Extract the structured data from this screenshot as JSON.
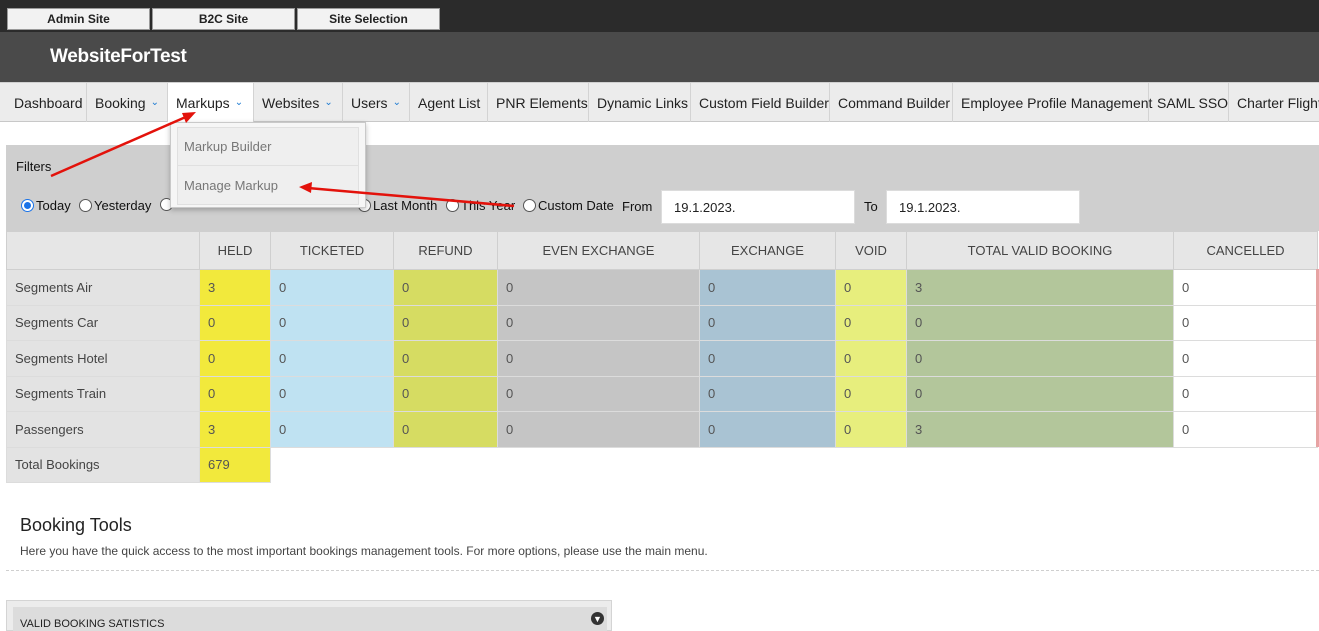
{
  "topbar": {
    "buttons": [
      "Admin Site",
      "B2C Site",
      "Site Selection"
    ]
  },
  "brand": "WebsiteForTest",
  "nav": {
    "items": [
      {
        "label": "Dashboard"
      },
      {
        "label": "Booking",
        "chevron": true
      },
      {
        "label": "Markups",
        "chevron": true,
        "active": true
      },
      {
        "label": "Websites",
        "chevron": true
      },
      {
        "label": "Users",
        "chevron": true
      },
      {
        "label": "Agent List"
      },
      {
        "label": "PNR Elements"
      },
      {
        "label": "Dynamic Links"
      },
      {
        "label": "Custom Field Builder"
      },
      {
        "label": "Command Builder"
      },
      {
        "label": "Employee Profile Management"
      },
      {
        "label": "SAML SSO"
      },
      {
        "label": "Charter Flight"
      }
    ],
    "dropdown": [
      "Markup Builder",
      "Manage Markup"
    ]
  },
  "filters": {
    "title": "Filters",
    "radios": [
      "Today",
      "Yesterday",
      "Last Month",
      "This Year",
      "Custom Date"
    ],
    "selected": "Today",
    "from_label": "From",
    "from_value": "19.1.2023.",
    "to_label": "To",
    "to_value": "19.1.2023."
  },
  "table": {
    "columns": [
      "HELD",
      "TICKETED",
      "REFUND",
      "EVEN EXCHANGE",
      "EXCHANGE",
      "VOID",
      "TOTAL VALID BOOKING",
      "CANCELLED"
    ],
    "rows": [
      {
        "label": "Segments Air",
        "values": [
          "3",
          "0",
          "0",
          "0",
          "0",
          "0",
          "3",
          "0"
        ]
      },
      {
        "label": "Segments Car",
        "values": [
          "0",
          "0",
          "0",
          "0",
          "0",
          "0",
          "0",
          "0"
        ]
      },
      {
        "label": "Segments Hotel",
        "values": [
          "0",
          "0",
          "0",
          "0",
          "0",
          "0",
          "0",
          "0"
        ]
      },
      {
        "label": "Segments Train",
        "values": [
          "0",
          "0",
          "0",
          "0",
          "0",
          "0",
          "0",
          "0"
        ]
      },
      {
        "label": "Passengers",
        "values": [
          "3",
          "0",
          "0",
          "0",
          "0",
          "0",
          "3",
          "0"
        ]
      }
    ],
    "total": {
      "label": "Total Bookings",
      "value": "679"
    },
    "colors": {
      "held": "#f2e93c",
      "ticketed": "#bfe2f2",
      "refund": "#d6dc62",
      "even_exchange": "#c5c5c5",
      "exchange": "#a9c3d3",
      "void": "#e7ee7d",
      "total_valid": "#b3c69b",
      "cancelled": "#ffffff"
    }
  },
  "booking_tools": {
    "title": "Booking Tools",
    "description": "Here you have the quick access to the most important bookings management tools. For more options, please use the main menu.",
    "panel_title": "VALID BOOKING SATISTICS",
    "panel_icon": "chevron-down-circle-icon"
  },
  "annotation_color": "#e3120b"
}
